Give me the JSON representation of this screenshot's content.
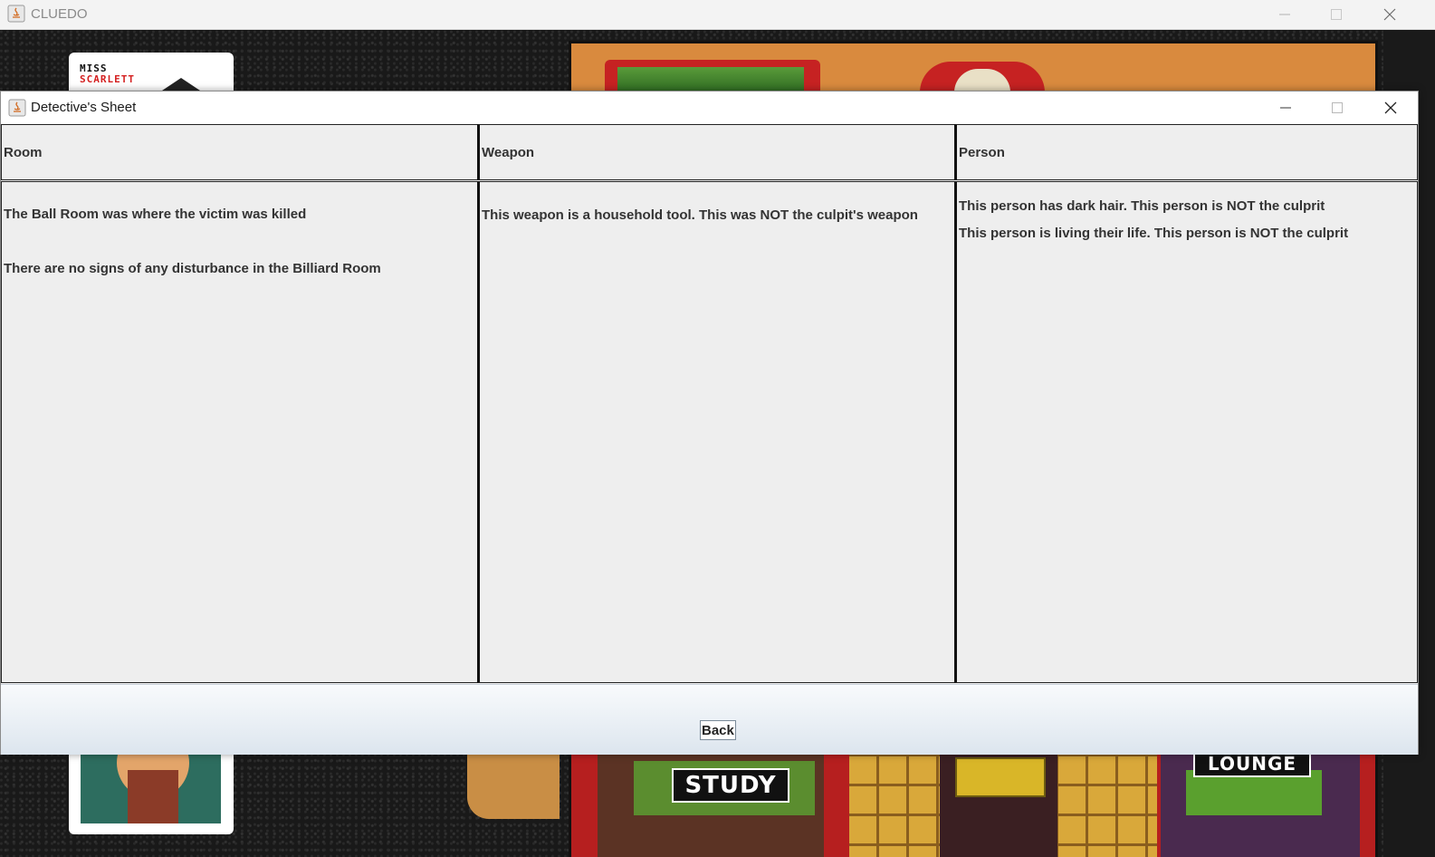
{
  "main_window": {
    "title": "CLUEDO",
    "character": {
      "line1": "MISS",
      "line2": "SCARLETT"
    },
    "board": {
      "rooms": [
        "STUDY",
        "LOUNGE"
      ]
    }
  },
  "dialog": {
    "title": "Detective's Sheet",
    "columns": [
      {
        "header": "Room",
        "clues": [
          "The Ball Room was where the victim was killed",
          "There are no signs of any disturbance in the Billiard Room"
        ]
      },
      {
        "header": "Weapon",
        "clues": [
          "This weapon is a household tool. This was NOT the culpit's weapon"
        ]
      },
      {
        "header": "Person",
        "clues": [
          "This person has dark hair. This person is NOT the culprit",
          "This person is living their life. This person is NOT the culprit"
        ]
      }
    ],
    "back_label": "Back"
  },
  "icons": [
    "java-app-icon",
    "minimize-icon",
    "maximize-icon",
    "close-icon"
  ],
  "colors": {
    "board_red": "#c62222",
    "board_orange": "#d98a3e",
    "character_red": "#d42020"
  }
}
